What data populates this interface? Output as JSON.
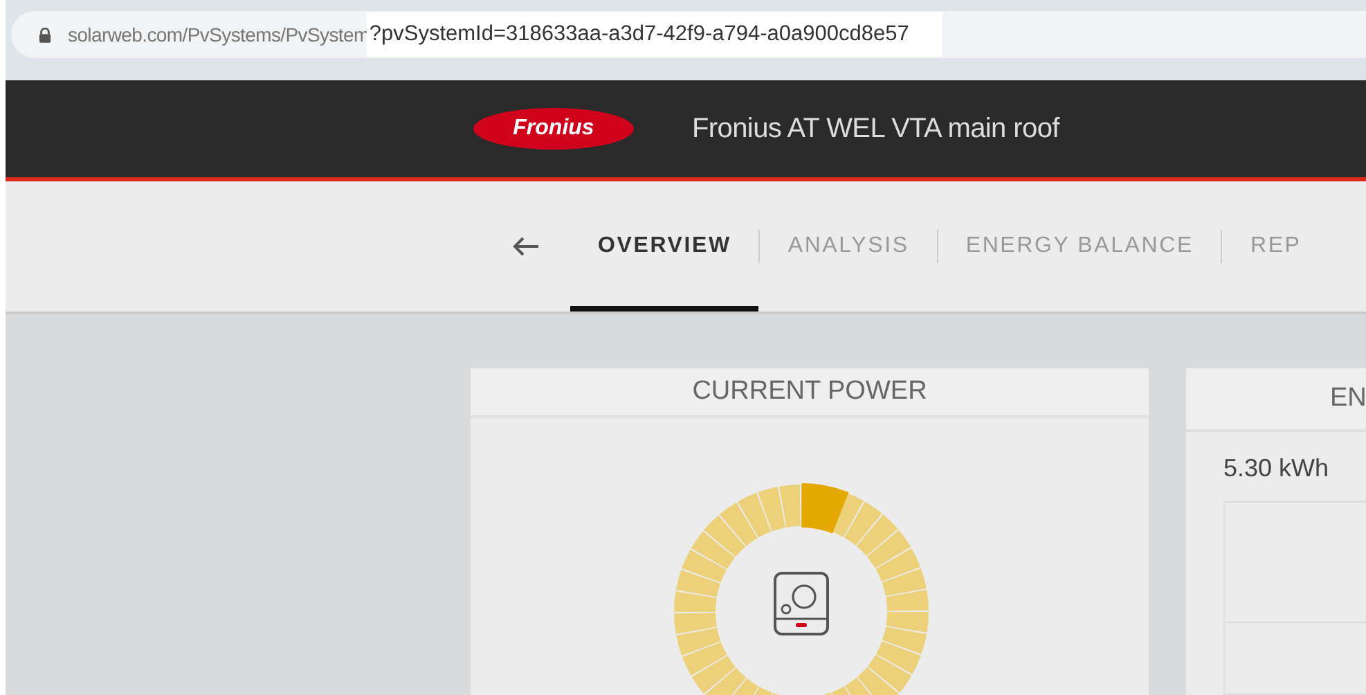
{
  "address_bar": {
    "url_prefix": "solarweb.com/PvSystems/PvSystem",
    "url_selected": "?pvSystemId=318633aa-a3d7-42f9-a794-a0a900cd8e57"
  },
  "header": {
    "logo": "Fronius",
    "title": "Fronius AT WEL VTA main roof"
  },
  "tabs": [
    {
      "label": "OVERVIEW",
      "selected": true
    },
    {
      "label": "ANALYSIS",
      "selected": false
    },
    {
      "label": "ENERGY BALANCE",
      "selected": false
    },
    {
      "label": "REP",
      "selected": false
    }
  ],
  "cards": [
    {
      "kind": "gauge",
      "title": "CURRENT POWER"
    },
    {
      "kind": "energy",
      "title": "EN",
      "value": "5.30 kWh"
    }
  ]
}
